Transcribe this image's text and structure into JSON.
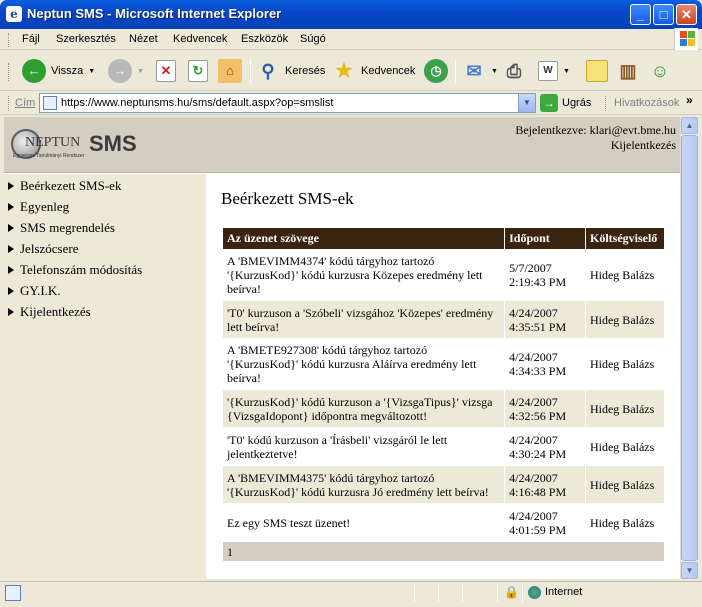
{
  "window": {
    "title": "Neptun SMS - Microsoft Internet Explorer"
  },
  "menu": [
    "Fájl",
    "Szerkesztés",
    "Nézet",
    "Kedvencek",
    "Eszközök",
    "Súgó"
  ],
  "toolbar": {
    "back": "Vissza",
    "search": "Keresés",
    "favorites": "Kedvencek"
  },
  "address": {
    "label": "Cím",
    "url": "https://www.neptunsms.hu/sms/default.aspx?op=smslist",
    "go": "Ugrás",
    "links": "Hivatkozások"
  },
  "header": {
    "logo_neptun": "NEPTUN",
    "logo_sms": "SMS",
    "logo_sub": "Egységes Tanulmányi Rendszer",
    "login_text": "Bejelentkezve: klari@evt.bme.hu",
    "logout": "Kijelentkezés"
  },
  "nav": [
    "Beérkezett SMS-ek",
    "Egyenleg",
    "SMS megrendelés",
    "Jelszócsere",
    "Telefonszám módosítás",
    "GY.I.K.",
    "Kijelentkezés"
  ],
  "content": {
    "title": "Beérkezett SMS-ek",
    "columns": [
      "Az üzenet szövege",
      "Időpont",
      "Költségviselő"
    ],
    "rows": [
      {
        "text": "A 'BMEVIMM4374' kódú tárgyhoz tartozó '{KurzusKod}' kódú kurzusra Közepes eredmény lett beírva!",
        "date": "5/7/2007",
        "time": "2:19:43 PM",
        "payer": "Hideg Balázs"
      },
      {
        "text": "'T0' kurzuson a 'Szóbeli' vizsgához 'Közepes' eredmény lett beírva!",
        "date": "4/24/2007",
        "time": "4:35:51 PM",
        "payer": "Hideg Balázs"
      },
      {
        "text": "A 'BMETE927308' kódú tárgyhoz tartozó '{KurzusKod}' kódú kurzusra Aláírva eredmény lett beírva!",
        "date": "4/24/2007",
        "time": "4:34:33 PM",
        "payer": "Hideg Balázs"
      },
      {
        "text": "'{KurzusKod}' kódú kurzuson a '{VizsgaTipus}' vizsga {VizsgaIdopont} időpontra megváltozott!",
        "date": "4/24/2007",
        "time": "4:32:56 PM",
        "payer": "Hideg Balázs"
      },
      {
        "text": "'T0' kódú kurzuson a 'Írásbeli' vizsgáról le lett jelentkeztetve!",
        "date": "4/24/2007",
        "time": "4:30:24 PM",
        "payer": "Hideg Balázs"
      },
      {
        "text": "A 'BMEVIMM4375' kódú tárgyhoz tartozó '{KurzusKod}' kódú kurzusra Jó eredmény lett beírva!",
        "date": "4/24/2007",
        "time": "4:16:48 PM",
        "payer": "Hideg Balázs"
      },
      {
        "text": "Ez egy SMS teszt üzenet!",
        "date": "4/24/2007",
        "time": "4:01:59 PM",
        "payer": "Hideg Balázs"
      }
    ],
    "page": "1"
  },
  "status": {
    "zone": "Internet"
  }
}
